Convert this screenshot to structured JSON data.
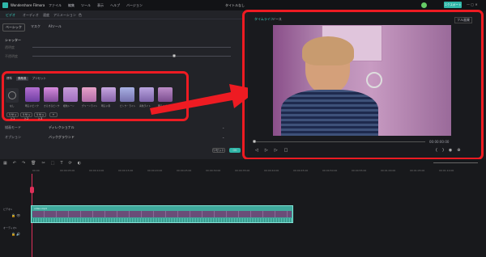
{
  "app": {
    "title": "Wondershare Filmora",
    "project": "タイトルなし",
    "export": "エクスポート"
  },
  "menu": [
    "ファイル",
    "編集",
    "ツール",
    "表示",
    "ヘルプ",
    "バージョン"
  ],
  "left_tabs": [
    "ビデオ",
    "オーディオ",
    "速度",
    "アニメーション",
    "色"
  ],
  "sub_tabs": [
    "ベーシック",
    "マスク",
    "AIツール"
  ],
  "rows": {
    "shutter": "シャッター",
    "row2": "透明度",
    "row3": "不透明度"
  },
  "filter_tabs": [
    "標準",
    "素敵風",
    "プリセット"
  ],
  "presets": [
    "なし",
    "明るいピンク",
    "きらきらピンク",
    "暖色トーン",
    "グリーンライト",
    "明るい赤",
    "ピンク・ライト",
    "青色ライト",
    "明るいビンク"
  ],
  "small_buttons": [
    "リセット1",
    "リセット2",
    "リセット3",
    "+"
  ],
  "blend": {
    "label": "描画モード",
    "value": "ディレクショナル"
  },
  "opacity": {
    "label": "オプション",
    "value": "バックグラウンド"
  },
  "panel_buttons": {
    "reset": "リセット",
    "ok": "OK"
  },
  "preview": {
    "tab_timeline": "タイムライン",
    "tab_source": "ソース",
    "quality": "フル画質",
    "time": "00:00:00:00"
  },
  "timeline": {
    "clip_name": "video.mp4",
    "track1": "ビデオ1",
    "track2": "オーディオ1",
    "ticks": [
      "00:00",
      "00:00:05:00",
      "00:00:10:00",
      "00:00:15:00",
      "00:00:20:00",
      "00:00:25:00",
      "00:00:30:00",
      "00:00:35:00",
      "00:00:40:00",
      "00:00:45:00",
      "00:00:50:00",
      "00:00:55:00",
      "00:01:00:00",
      "00:01:05:00",
      "00:01:10:00",
      "00:01:15:00"
    ]
  },
  "colors": {
    "accent": "#3bd6c6",
    "highlight": "#ee1b22",
    "clip": "#3fa99c"
  }
}
